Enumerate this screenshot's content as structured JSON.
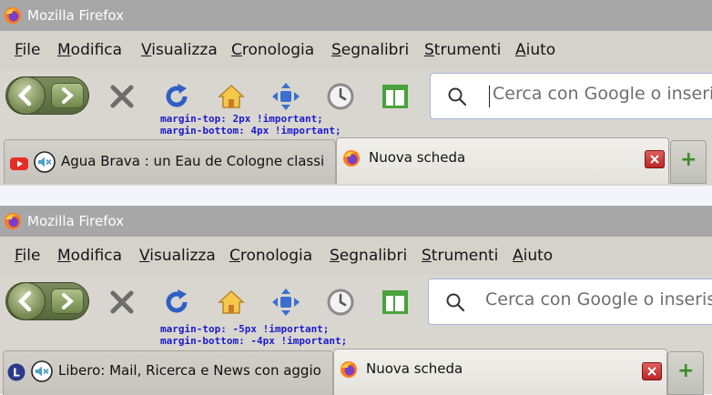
{
  "window": {
    "title": "Mozilla Firefox"
  },
  "menu": [
    "File",
    "Modifica",
    "Visualizza",
    "Cronologia",
    "Segnalibri",
    "Strumenti",
    "Aiuto"
  ],
  "icons": {
    "browser": "firefox-icon",
    "back": "back-arrow-icon",
    "forward": "forward-arrow-icon",
    "stop": "stop-x-icon",
    "reload": "reload-icon",
    "home": "home-icon",
    "pan": "pan-arrows-icon",
    "history": "clock-icon",
    "sidebar": "sidebar-panel-icon",
    "search": "search-icon",
    "mute": "speaker-muted-icon",
    "close": "close-icon",
    "add": "plus-icon"
  },
  "search": {
    "placeholder": "Cerca con Google o inserisci indirizzo"
  },
  "panels": [
    {
      "css_note": [
        "margin-top: 2px !important;",
        "margin-bottom: 4px !important;"
      ],
      "tabs": [
        {
          "label": "Agua Brava : un Eau de Cologne classi",
          "favicon": "youtube-icon",
          "active": false
        },
        {
          "label": "Nuova scheda",
          "favicon": "firefox-icon",
          "active": true
        }
      ]
    },
    {
      "css_note": [
        "margin-top: -5px !important;",
        "margin-bottom: -4px !important;"
      ],
      "tabs": [
        {
          "label": "Libero: Mail, Ricerca e News con aggio",
          "favicon": "libero-icon",
          "active": false
        },
        {
          "label": "Nuova scheda",
          "favicon": "firefox-icon",
          "active": true
        }
      ]
    }
  ],
  "new_tab_label": "+",
  "colors": {
    "titlebar": "#a7a7a7",
    "chrome": "#d9d6cf",
    "note": "#1a1acc",
    "new_tab_plus": "#3d8a2a",
    "close_button": "#c62b2b"
  }
}
